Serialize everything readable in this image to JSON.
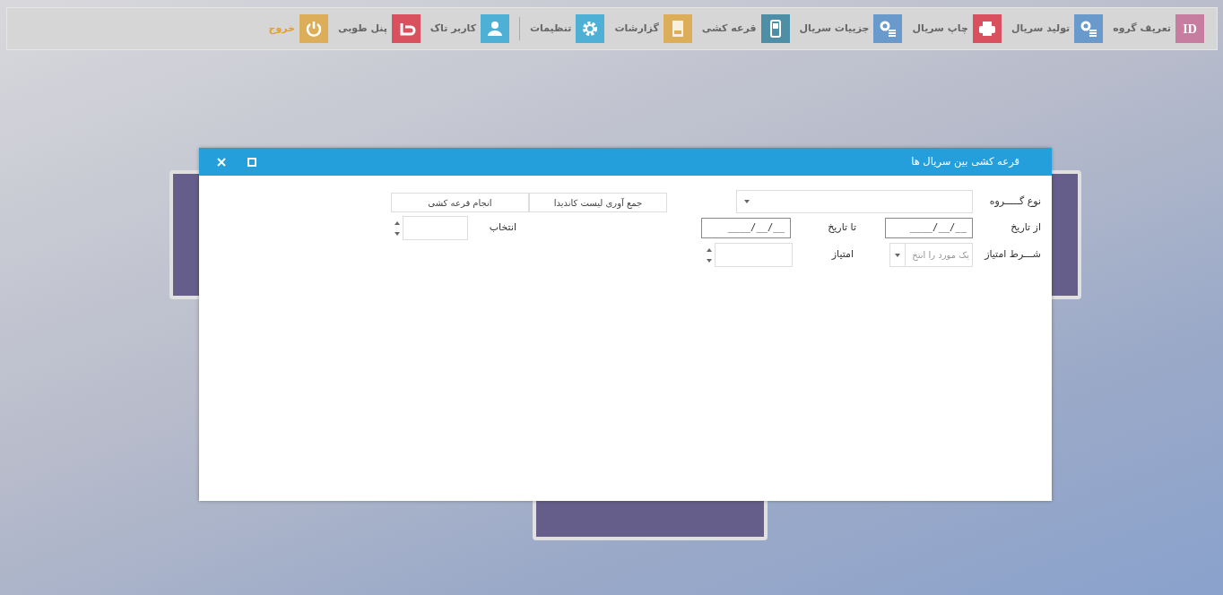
{
  "toolbar": {
    "items": [
      {
        "label": "تعریف گروه",
        "kind": "id",
        "icon_text": "ID",
        "color": "#c77d9f"
      },
      {
        "label": "تولید سریال",
        "kind": "gears",
        "color": "#6a9acb"
      },
      {
        "label": "چاپ سریال",
        "kind": "printer",
        "color": "#d9505e"
      },
      {
        "label": "جزییات سریال",
        "kind": "gears",
        "color": "#6a9acb"
      },
      {
        "label": "قرعه کشی",
        "kind": "phone",
        "color": "#4f8fa5"
      },
      {
        "label": "گزارشات",
        "kind": "book",
        "color": "#dcae5a"
      },
      {
        "label": "تنظیمات",
        "kind": "gear",
        "color": "#4fb0d6",
        "separator_after": true
      },
      {
        "label": "کاربر تاک",
        "kind": "user",
        "color": "#4fb0d6"
      },
      {
        "label": "پنل طوبی",
        "kind": "tooba",
        "color": "#d9505e"
      },
      {
        "label": "خروج",
        "kind": "power",
        "color": "#dcae5a"
      }
    ]
  },
  "dialog": {
    "title": "قرعه کشی بین سریال ها",
    "group_type": {
      "label": "نوع گـــــروه"
    },
    "from_date": {
      "label": "از تاریخ",
      "value": "____/__/__"
    },
    "to_date": {
      "label": "تا تاریخ",
      "value": "____/__/__"
    },
    "score_condition": {
      "label": "شـــرط امتیاز",
      "placeholder": "یک مورد را انتخ"
    },
    "score": {
      "label": "امتیاز"
    },
    "buttons": [
      "جمع آوری لیست کاندیدا",
      "انجام قرعه کشی"
    ],
    "selection": {
      "label": "انتخاب"
    }
  }
}
